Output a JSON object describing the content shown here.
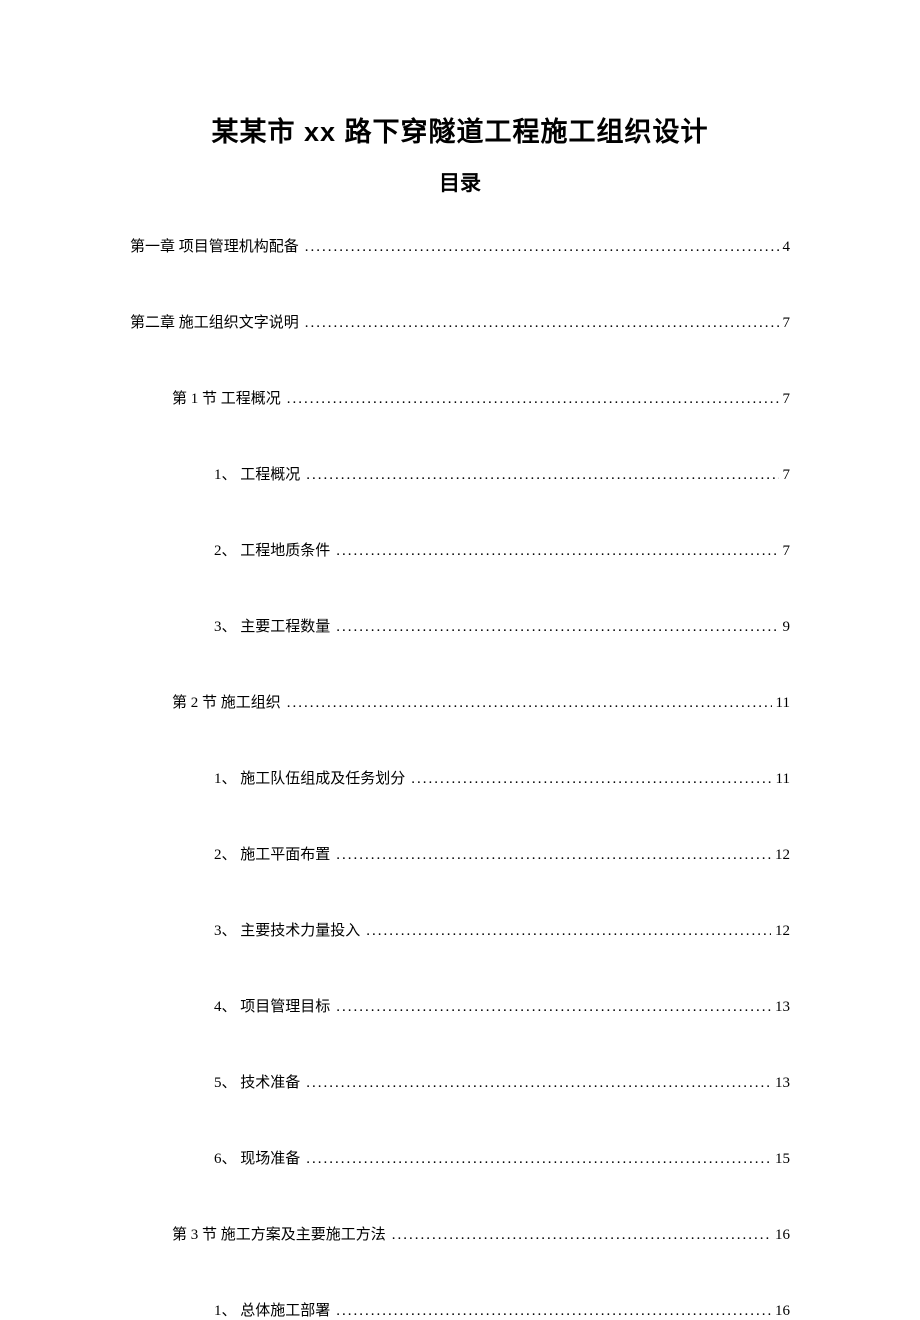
{
  "title": "某某市 xx 路下穿隧道工程施工组织设计",
  "subtitle": "目录",
  "entries": [
    {
      "level": 1,
      "label": "第一章 项目管理机构配备",
      "page": "4"
    },
    {
      "level": 1,
      "label": "第二章 施工组织文字说明",
      "page": "7"
    },
    {
      "level": 2,
      "label": "第 1 节 工程概况",
      "page": "7"
    },
    {
      "level": 3,
      "label": "1、 工程概况",
      "page": "7"
    },
    {
      "level": 3,
      "label": "2、 工程地质条件",
      "page": "7"
    },
    {
      "level": 3,
      "label": "3、 主要工程数量",
      "page": "9"
    },
    {
      "level": 2,
      "label": "第 2 节 施工组织",
      "page": "11"
    },
    {
      "level": 3,
      "label": "1、 施工队伍组成及任务划分",
      "page": "11"
    },
    {
      "level": 3,
      "label": "2、 施工平面布置",
      "page": "12"
    },
    {
      "level": 3,
      "label": "3、 主要技术力量投入",
      "page": "12"
    },
    {
      "level": 3,
      "label": "4、 项目管理目标",
      "page": "13"
    },
    {
      "level": 3,
      "label": "5、 技术准备",
      "page": "13"
    },
    {
      "level": 3,
      "label": "6、 现场准备",
      "page": "15"
    },
    {
      "level": 2,
      "label": "第 3 节 施工方案及主要施工方法",
      "page": "16"
    },
    {
      "level": 3,
      "label": "1、 总体施工部署",
      "page": "16"
    }
  ]
}
